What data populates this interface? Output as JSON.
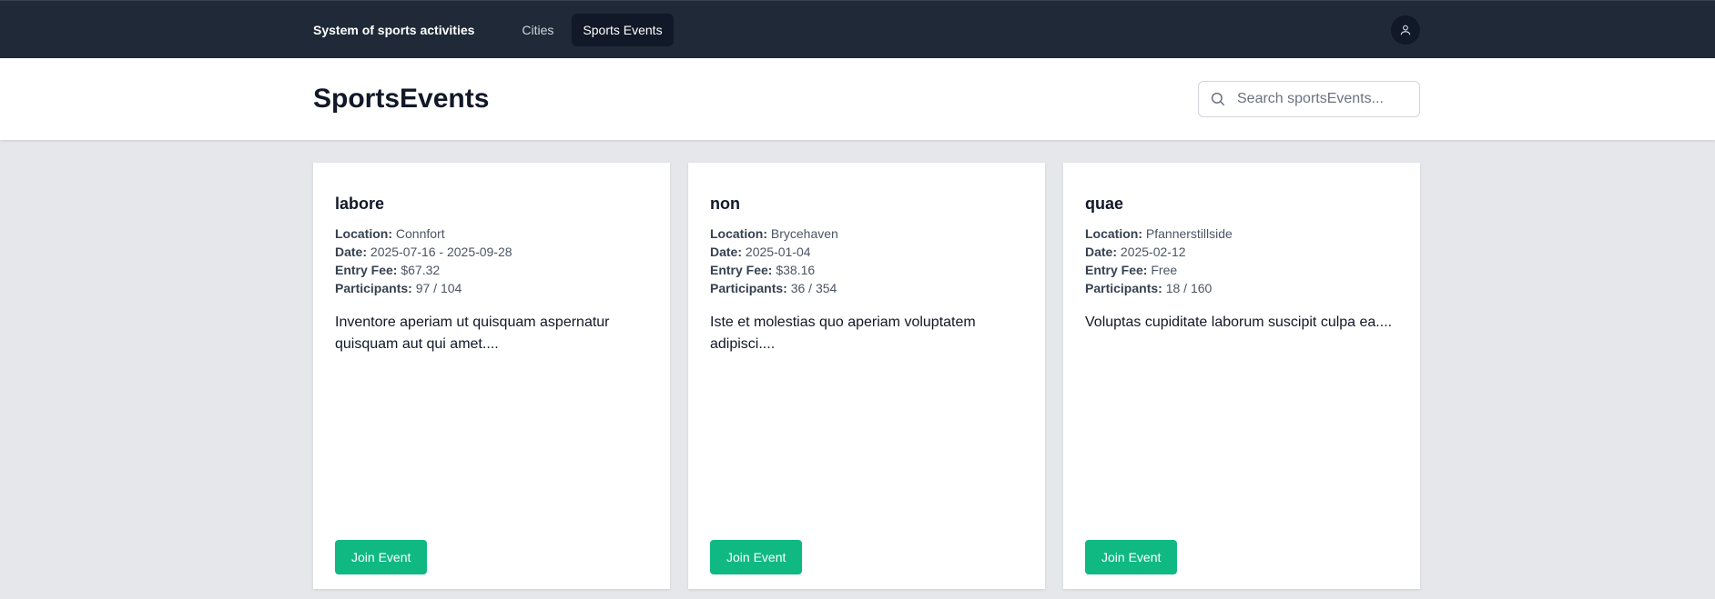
{
  "nav": {
    "brand": "System of sports activities",
    "links": [
      {
        "label": "Cities"
      },
      {
        "label": "Sports Events"
      }
    ],
    "user_icon": "user-icon"
  },
  "header": {
    "title": "SportsEvents",
    "search_placeholder": "Search sportsEvents...",
    "search_icon": "search-icon"
  },
  "labels": {
    "location": "Location:",
    "date": "Date:",
    "entry_fee": "Entry Fee:",
    "participants": "Participants:"
  },
  "events": [
    {
      "title": "labore",
      "location": "Connfort",
      "date": "2025-07-16 - 2025-09-28",
      "entry_fee": "$67.32",
      "participants": "97 / 104",
      "description": "Inventore aperiam ut quisquam aspernatur quisquam aut qui amet....",
      "button": "Join Event"
    },
    {
      "title": "non",
      "location": "Brycehaven",
      "date": "2025-01-04",
      "entry_fee": "$38.16",
      "participants": "36 / 354",
      "description": "Iste et molestias quo aperiam voluptatem adipisci....",
      "button": "Join Event"
    },
    {
      "title": "quae",
      "location": "Pfannerstillside",
      "date": "2025-02-12",
      "entry_fee": "Free",
      "participants": "18 / 160",
      "description": "Voluptas cupiditate laborum suscipit culpa ea....",
      "button": "Join Event"
    }
  ],
  "colors": {
    "nav_bg": "#1f2937",
    "accent": "#10b981",
    "page_bg": "#e5e7eb"
  }
}
